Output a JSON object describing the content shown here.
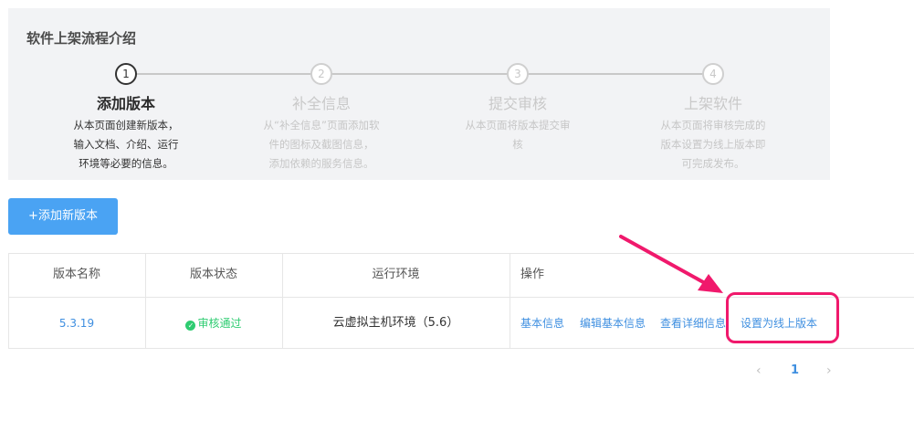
{
  "intro": {
    "title": "软件上架流程介绍",
    "steps": [
      {
        "num": "1",
        "title": "添加版本",
        "desc": [
          "从本页面创建新版本，",
          "输入文档、介绍、运行",
          "环境等必要的信息。"
        ]
      },
      {
        "num": "2",
        "title": "补全信息",
        "desc": [
          "从“补全信息”页面添加软",
          "件的图标及截图信息，",
          "添加依赖的服务信息。"
        ]
      },
      {
        "num": "3",
        "title": "提交审核",
        "desc": [
          "从本页面将版本提交审",
          "核"
        ]
      },
      {
        "num": "4",
        "title": "上架软件",
        "desc": [
          "从本页面将审核完成的",
          "版本设置为线上版本即",
          "可完成发布。"
        ]
      }
    ]
  },
  "add_button": "+添加新版本",
  "table": {
    "headers": [
      "版本名称",
      "版本状态",
      "运行环境",
      "操作"
    ],
    "row": {
      "version": "5.3.19",
      "status": "审核通过",
      "env": "云虚拟主机环境（5.6）",
      "actions": [
        "基本信息",
        "编辑基本信息",
        "查看详细信息",
        "设置为线上版本"
      ]
    }
  },
  "pagination": {
    "prev": "‹",
    "current": "1",
    "next": "›"
  },
  "colors": {
    "accent": "#4aa3f3",
    "link": "#3f8fe0",
    "success": "#2ecc71",
    "annotation": "#f0196c"
  }
}
